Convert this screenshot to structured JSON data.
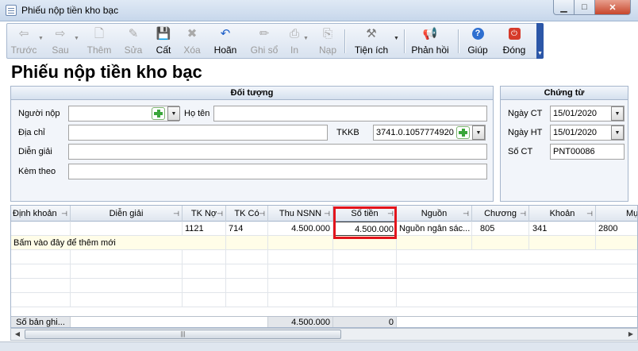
{
  "window": {
    "title": "Phiếu nộp tiền kho bạc",
    "min": "▁",
    "max": "□",
    "close": "✕"
  },
  "toolbar": {
    "prev": "Trước",
    "next": "Sau",
    "add": "Thêm",
    "edit": "Sửa",
    "save": "Cất",
    "delete": "Xóa",
    "undo": "Hoãn",
    "post": "Ghi sổ",
    "print": "In",
    "load": "Nạp",
    "utilities": "Tiện ích",
    "feedback": "Phản hồi",
    "help": "Giúp",
    "close": "Đóng"
  },
  "page_title": "Phiếu nộp tiền kho bạc",
  "subject": {
    "header": "Đối tượng",
    "payer_label": "Người nộp",
    "payer_value": "",
    "name_label": "Họ tên",
    "name_value": "",
    "address_label": "Địa chỉ",
    "address_value": "",
    "tkkb_label": "TKKB",
    "tkkb_value": "3741.0.1057774920",
    "description_label": "Diễn giải",
    "description_value": "",
    "attach_label": "Kèm theo",
    "attach_value": ""
  },
  "voucher": {
    "header": "Chứng từ",
    "ct_date_label": "Ngày CT",
    "ct_date_value": "15/01/2020",
    "ht_date_label": "Ngày HT",
    "ht_date_value": "15/01/2020",
    "no_label": "Số CT",
    "no_value": "PNT00086"
  },
  "grid": {
    "columns": [
      "Định khoản",
      "Diễn giải",
      "TK Nợ",
      "TK Có",
      "Thu NSNN",
      "Số tiền",
      "Nguồn",
      "Chương",
      "Khoản",
      "Mục"
    ],
    "row": [
      "",
      "",
      "1121",
      "714",
      "4.500.000",
      "4.500.000",
      "Nguồn ngân sác...",
      "805",
      "341",
      "2800"
    ],
    "new_row_hint": "Bấm vào đây để thêm mới",
    "footer": {
      "count_label": "Số bản ghi...",
      "thu_total": "4.500.000",
      "amount_total": "0"
    }
  },
  "colors": {
    "accent": "#2c57a8",
    "highlight": "#e3141c",
    "new_row_bg": "#fffde8"
  }
}
